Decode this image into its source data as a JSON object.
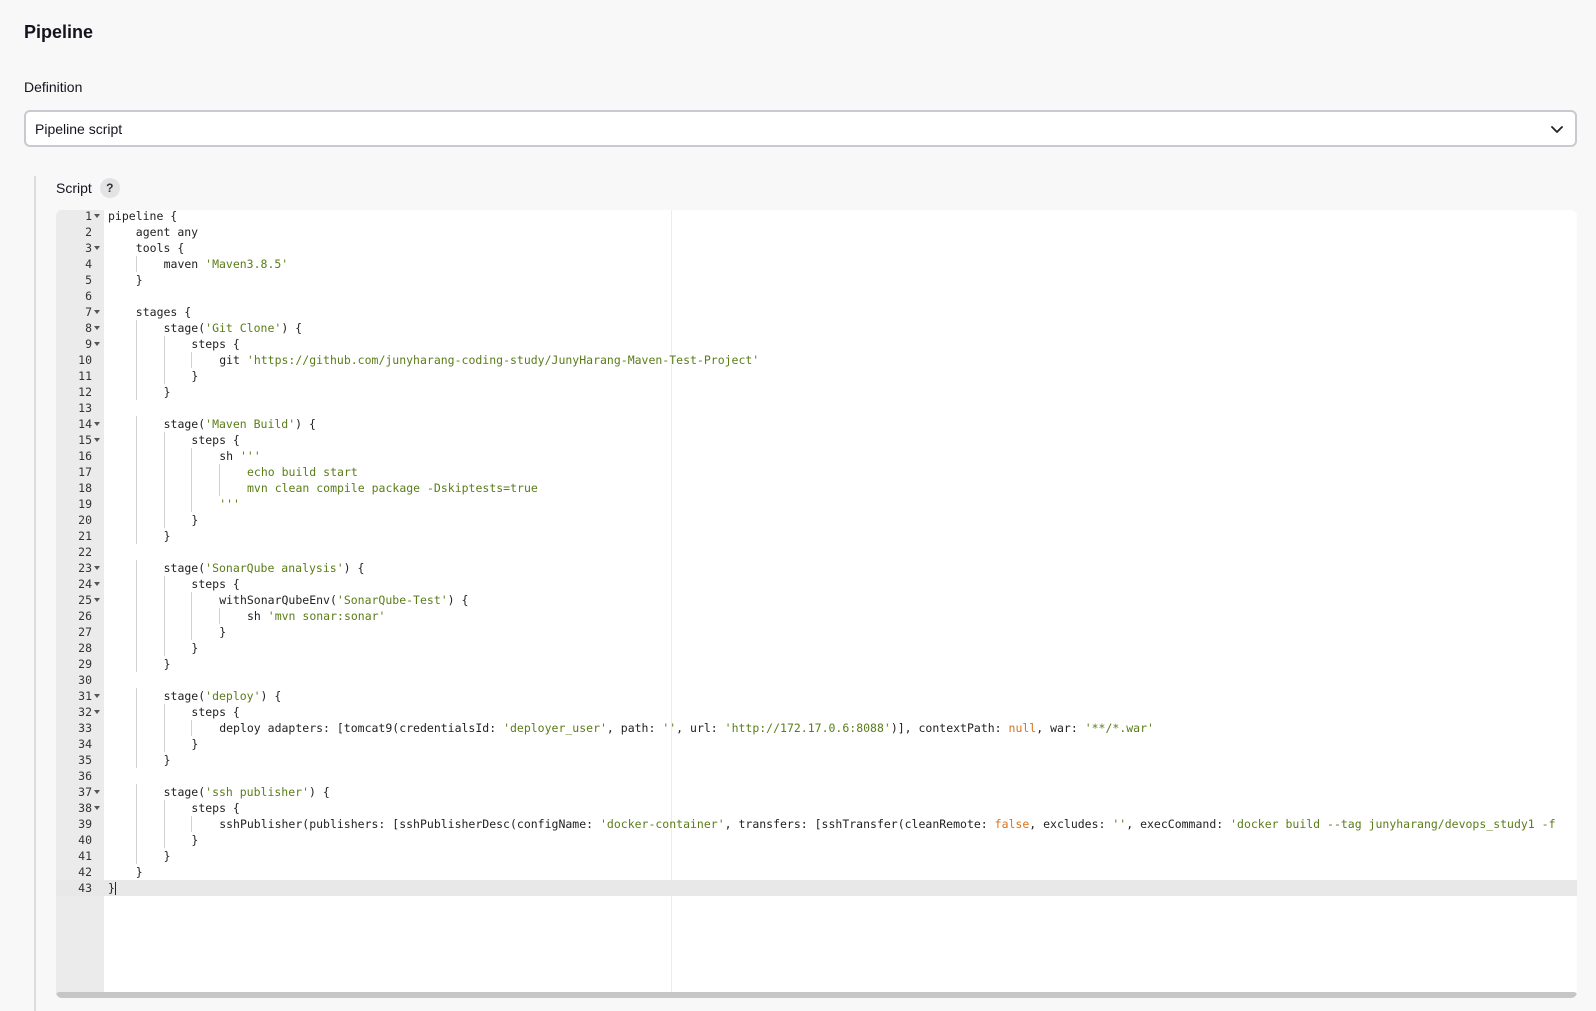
{
  "section": {
    "title": "Pipeline"
  },
  "definition": {
    "label": "Definition",
    "selected": "Pipeline script"
  },
  "script": {
    "label": "Script",
    "help": "?",
    "active_line": 43,
    "lines": [
      {
        "n": "1",
        "fold": true,
        "indent": 0,
        "parts": [
          [
            "t",
            "pipeline {"
          ]
        ]
      },
      {
        "n": "2",
        "fold": false,
        "indent": 1,
        "parts": [
          [
            "t",
            "agent any"
          ]
        ]
      },
      {
        "n": "3",
        "fold": true,
        "indent": 1,
        "parts": [
          [
            "t",
            "tools {"
          ]
        ]
      },
      {
        "n": "4",
        "fold": false,
        "indent": 2,
        "parts": [
          [
            "t",
            "maven "
          ],
          [
            "s",
            "'Maven3.8.5'"
          ]
        ]
      },
      {
        "n": "5",
        "fold": false,
        "indent": 1,
        "parts": [
          [
            "t",
            "}"
          ]
        ]
      },
      {
        "n": "6",
        "fold": false,
        "indent": 0,
        "parts": []
      },
      {
        "n": "7",
        "fold": true,
        "indent": 1,
        "parts": [
          [
            "t",
            "stages {"
          ]
        ]
      },
      {
        "n": "8",
        "fold": true,
        "indent": 2,
        "parts": [
          [
            "t",
            "stage("
          ],
          [
            "s",
            "'Git Clone'"
          ],
          [
            "t",
            ") {"
          ]
        ]
      },
      {
        "n": "9",
        "fold": true,
        "indent": 3,
        "parts": [
          [
            "t",
            "steps {"
          ]
        ]
      },
      {
        "n": "10",
        "fold": false,
        "indent": 4,
        "parts": [
          [
            "t",
            "git "
          ],
          [
            "s",
            "'https://github.com/junyharang-coding-study/JunyHarang-Maven-Test-Project'"
          ]
        ]
      },
      {
        "n": "11",
        "fold": false,
        "indent": 3,
        "parts": [
          [
            "t",
            "}"
          ]
        ]
      },
      {
        "n": "12",
        "fold": false,
        "indent": 2,
        "parts": [
          [
            "t",
            "}"
          ]
        ]
      },
      {
        "n": "13",
        "fold": false,
        "indent": 0,
        "parts": []
      },
      {
        "n": "14",
        "fold": true,
        "indent": 2,
        "parts": [
          [
            "t",
            "stage("
          ],
          [
            "s",
            "'Maven Build'"
          ],
          [
            "t",
            ") {"
          ]
        ]
      },
      {
        "n": "15",
        "fold": true,
        "indent": 3,
        "parts": [
          [
            "t",
            "steps {"
          ]
        ]
      },
      {
        "n": "16",
        "fold": false,
        "indent": 4,
        "parts": [
          [
            "t",
            "sh "
          ],
          [
            "s",
            "'''"
          ]
        ]
      },
      {
        "n": "17",
        "fold": false,
        "indent": 5,
        "parts": [
          [
            "s",
            "echo build start"
          ]
        ]
      },
      {
        "n": "18",
        "fold": false,
        "indent": 5,
        "parts": [
          [
            "s",
            "mvn clean compile package -Dskiptests=true"
          ]
        ]
      },
      {
        "n": "19",
        "fold": false,
        "indent": 4,
        "parts": [
          [
            "s",
            "'''"
          ]
        ]
      },
      {
        "n": "20",
        "fold": false,
        "indent": 3,
        "parts": [
          [
            "t",
            "}"
          ]
        ]
      },
      {
        "n": "21",
        "fold": false,
        "indent": 2,
        "parts": [
          [
            "t",
            "}"
          ]
        ]
      },
      {
        "n": "22",
        "fold": false,
        "indent": 0,
        "parts": []
      },
      {
        "n": "23",
        "fold": true,
        "indent": 2,
        "parts": [
          [
            "t",
            "stage("
          ],
          [
            "s",
            "'SonarQube analysis'"
          ],
          [
            "t",
            ") {"
          ]
        ]
      },
      {
        "n": "24",
        "fold": true,
        "indent": 3,
        "parts": [
          [
            "t",
            "steps {"
          ]
        ]
      },
      {
        "n": "25",
        "fold": true,
        "indent": 4,
        "parts": [
          [
            "t",
            "withSonarQubeEnv("
          ],
          [
            "s",
            "'SonarQube-Test'"
          ],
          [
            "t",
            ") {"
          ]
        ]
      },
      {
        "n": "26",
        "fold": false,
        "indent": 5,
        "parts": [
          [
            "t",
            "sh "
          ],
          [
            "s",
            "'mvn sonar:sonar'"
          ]
        ]
      },
      {
        "n": "27",
        "fold": false,
        "indent": 4,
        "parts": [
          [
            "t",
            "}"
          ]
        ]
      },
      {
        "n": "28",
        "fold": false,
        "indent": 3,
        "parts": [
          [
            "t",
            "}"
          ]
        ]
      },
      {
        "n": "29",
        "fold": false,
        "indent": 2,
        "parts": [
          [
            "t",
            "}"
          ]
        ]
      },
      {
        "n": "30",
        "fold": false,
        "indent": 0,
        "parts": []
      },
      {
        "n": "31",
        "fold": true,
        "indent": 2,
        "parts": [
          [
            "t",
            "stage("
          ],
          [
            "s",
            "'deploy'"
          ],
          [
            "t",
            ") {"
          ]
        ]
      },
      {
        "n": "32",
        "fold": true,
        "indent": 3,
        "parts": [
          [
            "t",
            "steps {"
          ]
        ]
      },
      {
        "n": "33",
        "fold": false,
        "indent": 4,
        "parts": [
          [
            "t",
            "deploy adapters: [tomcat9(credentialsId: "
          ],
          [
            "s",
            "'deployer_user'"
          ],
          [
            "t",
            ", path: "
          ],
          [
            "s",
            "''"
          ],
          [
            "t",
            ", url: "
          ],
          [
            "s",
            "'http://172.17.0.6:8088'"
          ],
          [
            "t",
            ")], contextPath: "
          ],
          [
            "k",
            "null"
          ],
          [
            "t",
            ", war: "
          ],
          [
            "s",
            "'**/*.war'"
          ]
        ]
      },
      {
        "n": "34",
        "fold": false,
        "indent": 3,
        "parts": [
          [
            "t",
            "}"
          ]
        ]
      },
      {
        "n": "35",
        "fold": false,
        "indent": 2,
        "parts": [
          [
            "t",
            "}"
          ]
        ]
      },
      {
        "n": "36",
        "fold": false,
        "indent": 0,
        "parts": []
      },
      {
        "n": "37",
        "fold": true,
        "indent": 2,
        "parts": [
          [
            "t",
            "stage("
          ],
          [
            "s",
            "'ssh publisher'"
          ],
          [
            "t",
            ") {"
          ]
        ]
      },
      {
        "n": "38",
        "fold": true,
        "indent": 3,
        "parts": [
          [
            "t",
            "steps {"
          ]
        ]
      },
      {
        "n": "39",
        "fold": false,
        "indent": 4,
        "parts": [
          [
            "t",
            "sshPublisher(publishers: [sshPublisherDesc(configName: "
          ],
          [
            "s",
            "'docker-container'"
          ],
          [
            "t",
            ", transfers: [sshTransfer(cleanRemote: "
          ],
          [
            "k",
            "false"
          ],
          [
            "t",
            ", excludes: "
          ],
          [
            "s",
            "''"
          ],
          [
            "t",
            ", execCommand: "
          ],
          [
            "s",
            "'docker build --tag junyharang/devops_study1 -f"
          ]
        ]
      },
      {
        "n": "40",
        "fold": false,
        "indent": 3,
        "parts": [
          [
            "t",
            "}"
          ]
        ]
      },
      {
        "n": "41",
        "fold": false,
        "indent": 2,
        "parts": [
          [
            "t",
            "}"
          ]
        ]
      },
      {
        "n": "42",
        "fold": false,
        "indent": 1,
        "parts": [
          [
            "t",
            "}"
          ]
        ]
      },
      {
        "n": "43",
        "fold": false,
        "indent": 0,
        "parts": [
          [
            "t",
            "}"
          ]
        ]
      }
    ]
  }
}
